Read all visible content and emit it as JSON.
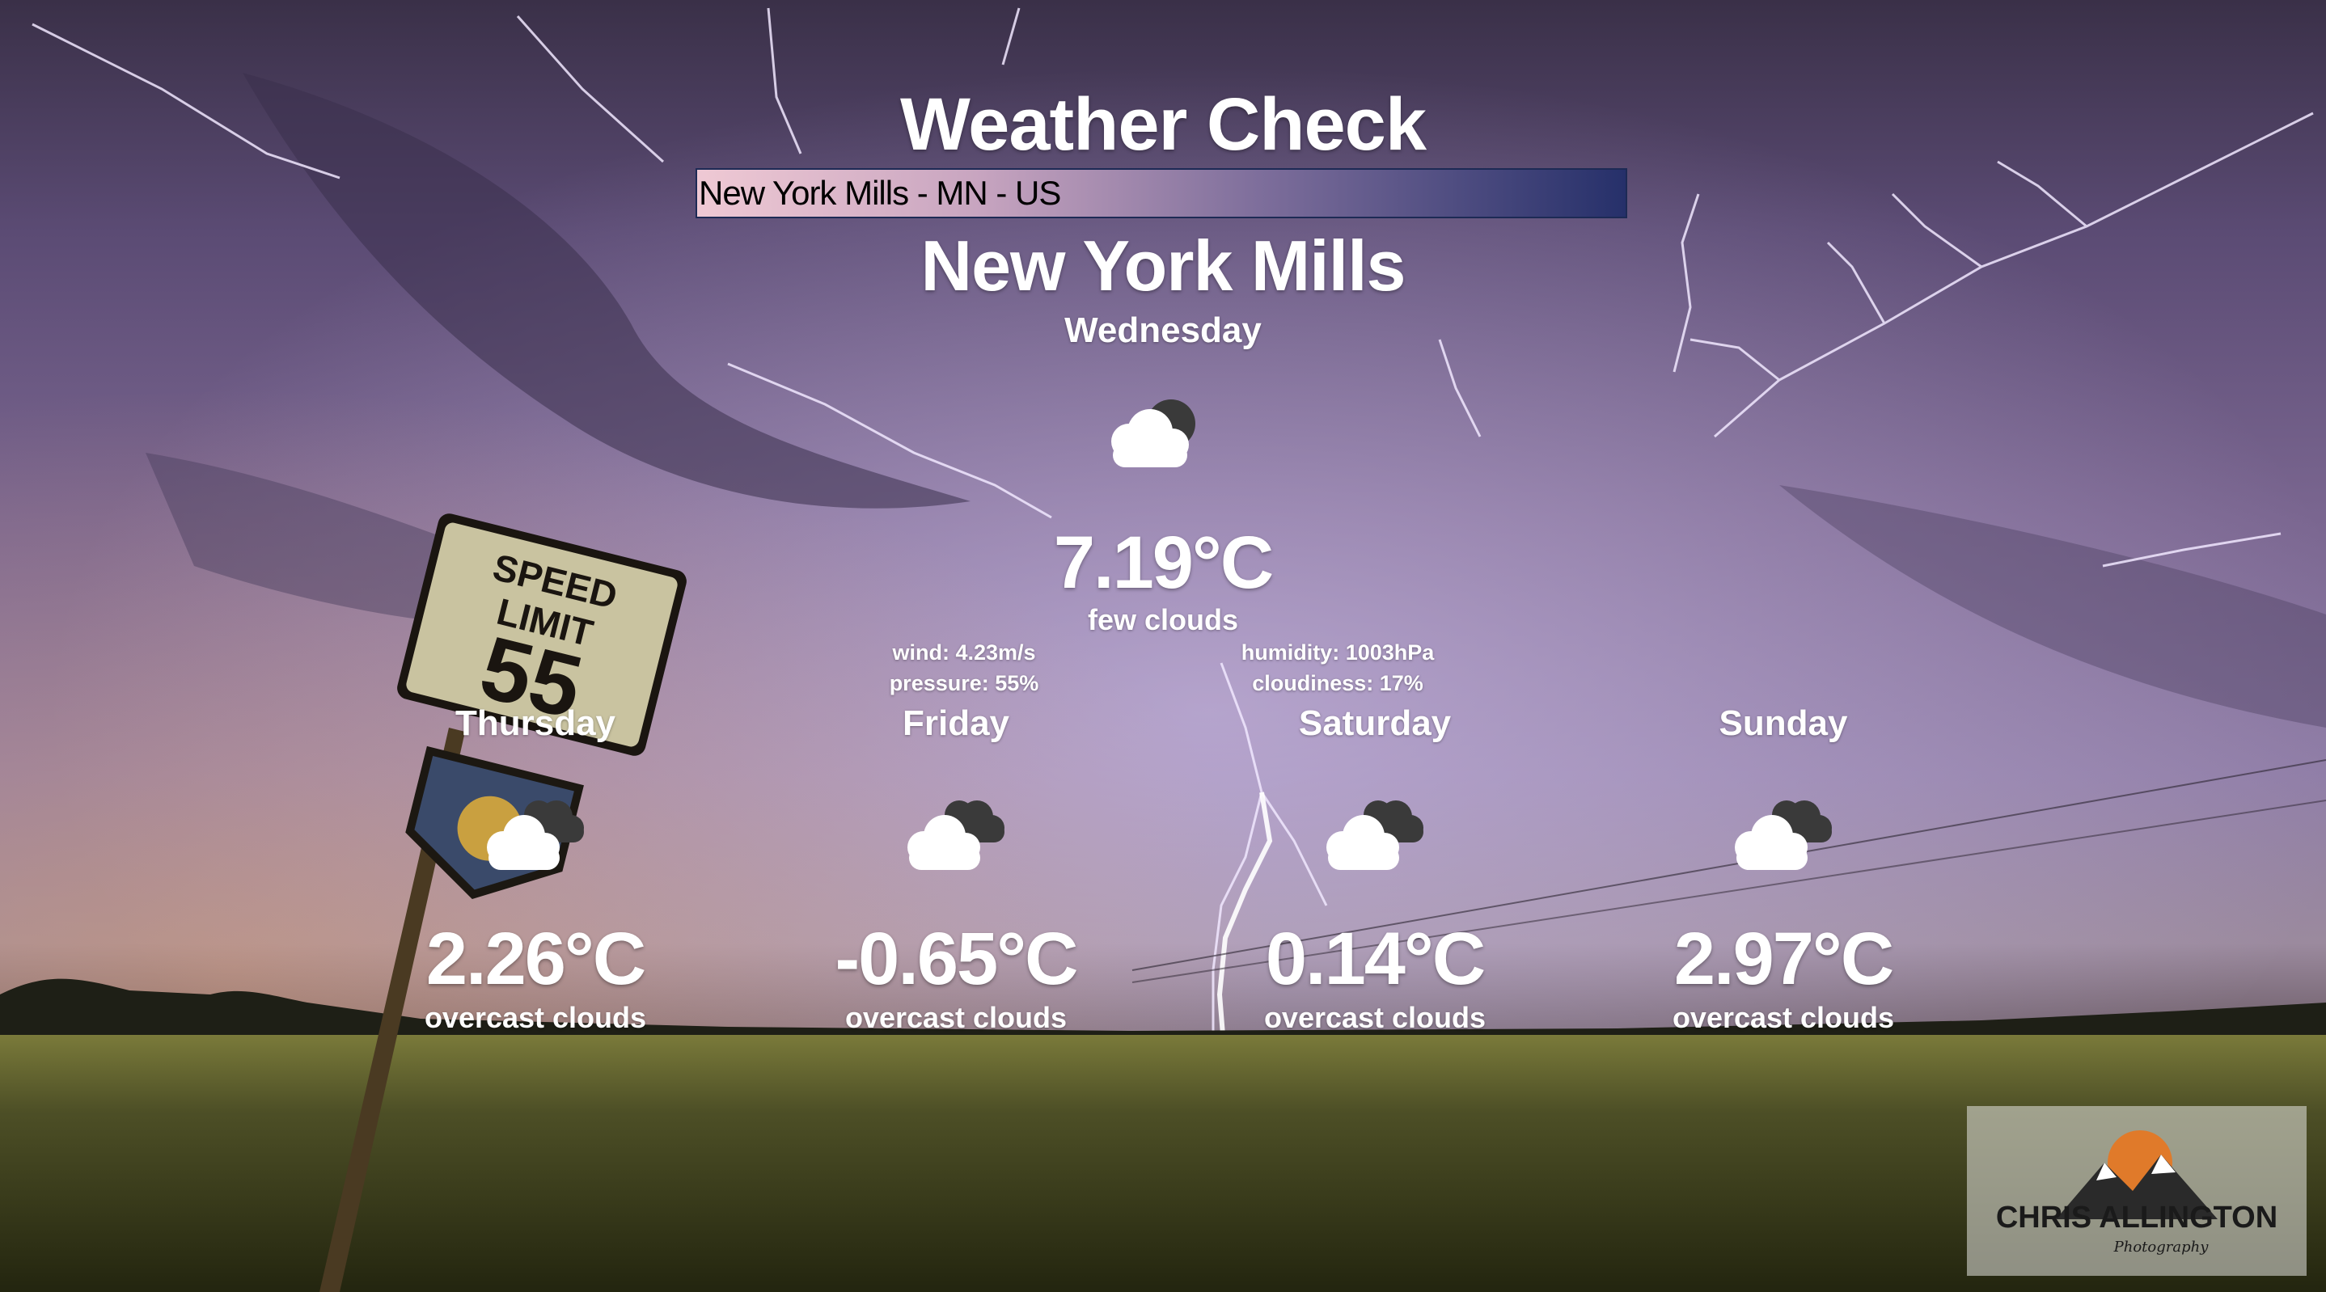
{
  "app": {
    "title": "Weather Check"
  },
  "search": {
    "value": "New York Mills - MN - US"
  },
  "current": {
    "city": "New York Mills",
    "day": "Wednesday",
    "icon": "few-clouds-icon",
    "temperature": "7.19°C",
    "description": "few clouds",
    "wind": "wind: 4.23m/s",
    "pressure": "pressure: 55%",
    "humidity": "humidity: 1003hPa",
    "cloudiness": "cloudiness: 17%"
  },
  "forecast": [
    {
      "day": "Thursday",
      "icon": "overcast-clouds-icon",
      "temperature": "2.26°C",
      "description": "overcast clouds"
    },
    {
      "day": "Friday",
      "icon": "overcast-clouds-icon",
      "temperature": "-0.65°C",
      "description": "overcast clouds"
    },
    {
      "day": "Saturday",
      "icon": "overcast-clouds-icon",
      "temperature": "0.14°C",
      "description": "overcast clouds"
    },
    {
      "day": "Sunday",
      "icon": "overcast-clouds-icon",
      "temperature": "2.97°C",
      "description": "overcast clouds"
    }
  ],
  "background": {
    "sign": {
      "line1": "SPEED",
      "line2": "LIMIT",
      "line3": "55"
    }
  },
  "watermark": {
    "text": "CHRIS ALLINGTON",
    "subtext": "Photography"
  },
  "colors": {
    "text": "#ffffff",
    "search_border": "#1d2a55",
    "sky": "#7a6690",
    "field": "#3e3c22"
  }
}
